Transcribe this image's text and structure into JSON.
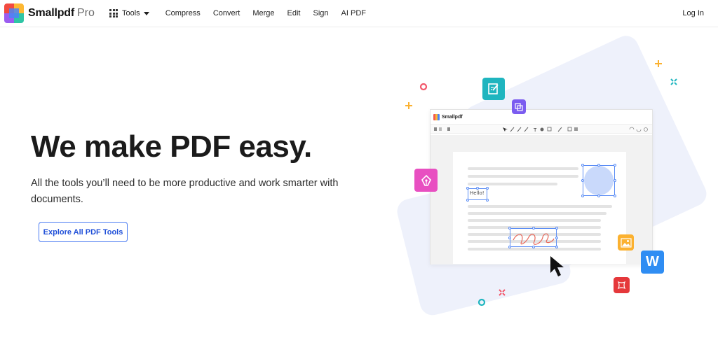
{
  "header": {
    "brand": "Smallpdf",
    "brand_suffix": "Pro",
    "nav": {
      "tools": "Tools",
      "compress": "Compress",
      "convert": "Convert",
      "merge": "Merge",
      "edit": "Edit",
      "sign": "Sign",
      "ai_pdf": "AI PDF"
    },
    "login": "Log In"
  },
  "hero": {
    "title": "We make PDF easy.",
    "subtitle": "All the tools you’ll need to be more productive and work smarter with documents.",
    "cta": "Explore All PDF Tools"
  },
  "illustration": {
    "window_title": "Smallpdf",
    "sample_text": "Hello!",
    "icons": [
      "edit-pdf-tile-icon",
      "copy-tile-icon",
      "sign-pen-tile-icon",
      "image-tile-icon",
      "word-tile-icon",
      "crop-tile-icon",
      "cursor-arrow-icon"
    ],
    "word_letter": "W"
  },
  "colors": {
    "brand_blue": "#1f4fd8",
    "teal": "#1fb5bf",
    "purple": "#7b5cf0",
    "pink": "#e84fc1",
    "orange": "#fbb130",
    "word_blue": "#2f8df3",
    "red": "#e5383b"
  }
}
